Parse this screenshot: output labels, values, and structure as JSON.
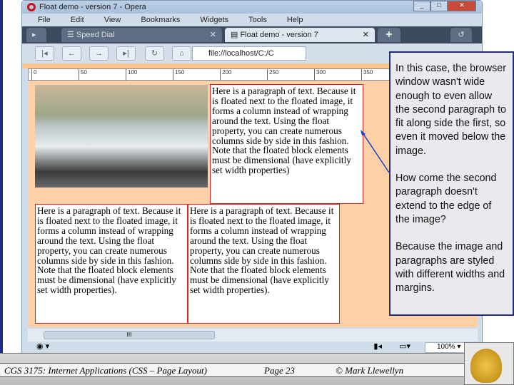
{
  "window": {
    "title": "Float demo - version 7 - Opera"
  },
  "menu": [
    "File",
    "Edit",
    "View",
    "Bookmarks",
    "Widgets",
    "Tools",
    "Help"
  ],
  "tabs": [
    {
      "label": "Speed Dial"
    },
    {
      "label": "Float demo - version 7"
    }
  ],
  "address": "file://localhost/C:/C",
  "ruler": [
    "0",
    "50",
    "100",
    "150",
    "200",
    "250",
    "300",
    "350",
    "400"
  ],
  "paragraph": "Here is a paragraph of text. Because it is floated next to the floated image, it forms a column instead of wrapping around the text. Using the float property, you can create numerous columns side by side in this fashion. Note that the floated block elements must be dimensional (have explicitly set width properties)",
  "paragraph_dot": "Here is a paragraph of text. Because it is floated next to the floated image, it forms a column instead of wrapping around the text. Using the float property, you can create numerous columns side by side in this fashion. Note that the floated block elements must be dimensional (have explicitly set width properties).",
  "scroll_thumb": "III",
  "zoom": "100%",
  "callout": [
    "In this case, the browser window wasn't wide enough to even allow the second paragraph to fit along side the first, so even it moved below the image.",
    "How come the second paragraph doesn't extend to the edge of the image?",
    "Because the image and paragraphs are styled with different widths and margins."
  ],
  "footer": {
    "course": "CGS 3175: Internet Applications (CSS – Page Layout)",
    "page": "Page 23",
    "author": "© Mark Llewellyn"
  },
  "colors": {
    "accent": "#232d7a",
    "content_bg": "#fdd0a8",
    "para_border": "#e02020"
  }
}
